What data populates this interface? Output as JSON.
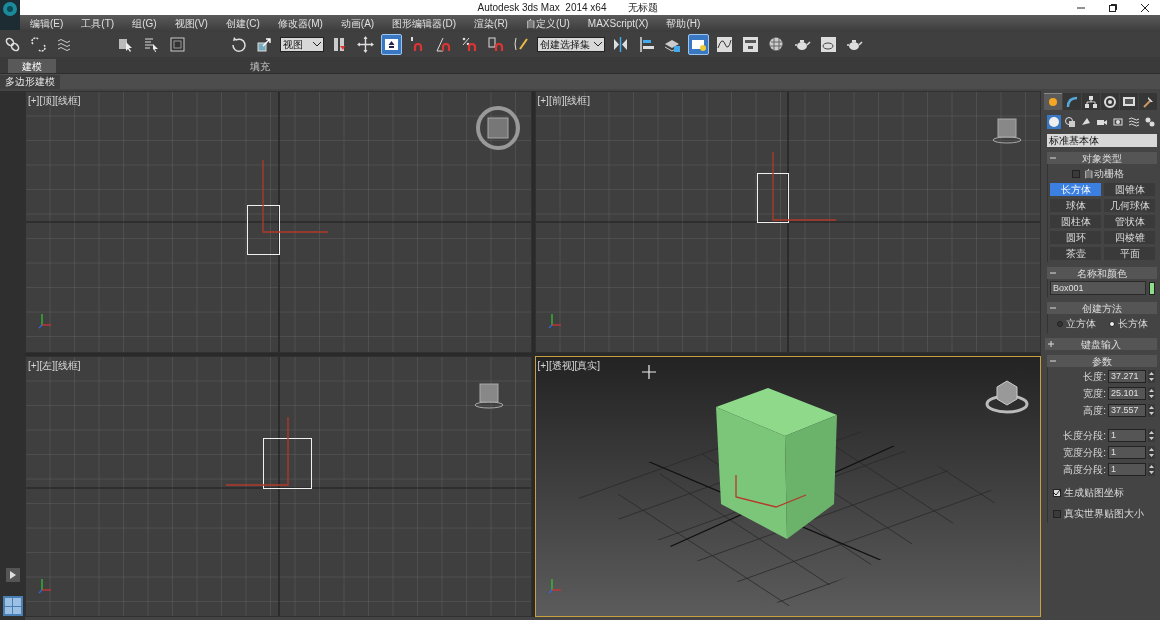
{
  "window": {
    "title": "Autodesk 3ds Max  2014 x64",
    "document": "无标题"
  },
  "menu": [
    "编辑(E)",
    "工具(T)",
    "组(G)",
    "视图(V)",
    "创建(C)",
    "修改器(M)",
    "动画(A)",
    "图形编辑器(D)",
    "渲染(R)",
    "自定义(U)",
    "MAXScript(X)",
    "帮助(H)"
  ],
  "toolbar": [
    {
      "kind": "link",
      "selected": false
    },
    {
      "kind": "unlink",
      "selected": false
    },
    {
      "kind": "wave",
      "selected": false
    },
    {
      "kind": "gap"
    },
    {
      "kind": "cursor",
      "selected": false
    },
    {
      "kind": "list",
      "selected": false
    },
    {
      "kind": "region",
      "selected": false
    },
    {
      "kind": "gap"
    },
    {
      "kind": "rotate",
      "selected": false
    },
    {
      "kind": "scale",
      "selected": false
    },
    {
      "kind": "dropdown",
      "value": "视图"
    },
    {
      "kind": "pivot",
      "selected": false
    },
    {
      "kind": "move",
      "selected": false
    },
    {
      "kind": "shortcut",
      "selected": true
    },
    {
      "kind": "snap",
      "selected": false
    },
    {
      "kind": "angle",
      "selected": false
    },
    {
      "kind": "percent",
      "selected": false
    },
    {
      "kind": "spinner",
      "selected": false
    },
    {
      "kind": "named",
      "selected": false
    },
    {
      "kind": "dropdown",
      "value": "创建选择集"
    },
    {
      "kind": "mirror",
      "selected": false
    },
    {
      "kind": "align",
      "selected": false
    },
    {
      "kind": "layers",
      "selected": false
    },
    {
      "kind": "explorer",
      "selected": true
    },
    {
      "kind": "curve",
      "selected": false
    },
    {
      "kind": "schematic",
      "selected": false
    },
    {
      "kind": "material",
      "selected": false
    },
    {
      "kind": "teapot",
      "selected": false
    },
    {
      "kind": "frame",
      "selected": false
    },
    {
      "kind": "teapot",
      "selected": false
    }
  ],
  "ribbon_tabs": [
    {
      "label": "建模",
      "selected": true
    },
    {
      "label": "填充",
      "selected": false
    }
  ],
  "ribbon_panel": "多边形建模",
  "viewports": [
    {
      "label": "[+][顶][线框]",
      "kind": "top",
      "active": false
    },
    {
      "label": "[+][前][线框]",
      "kind": "front",
      "active": false
    },
    {
      "label": "[+][左][线框]",
      "kind": "left",
      "active": false
    },
    {
      "label": "[+][透视][真实]",
      "kind": "perspective",
      "active": true
    }
  ],
  "command_panel": {
    "tabs": [
      {
        "kind": "create",
        "selected": true
      },
      {
        "kind": "modify",
        "selected": false
      },
      {
        "kind": "hierarchy",
        "selected": false
      },
      {
        "kind": "motion",
        "selected": false
      },
      {
        "kind": "display",
        "selected": false
      },
      {
        "kind": "utilities",
        "selected": false
      }
    ],
    "subtabs": [
      {
        "kind": "geometry",
        "selected": true
      },
      {
        "kind": "shapes",
        "selected": false
      },
      {
        "kind": "lights",
        "selected": false
      },
      {
        "kind": "cameras",
        "selected": false
      },
      {
        "kind": "helpers",
        "selected": false
      },
      {
        "kind": "spacewarps",
        "selected": false
      },
      {
        "kind": "systems",
        "selected": false
      }
    ],
    "category": "标准基本体",
    "rollouts": [
      {
        "kind": "object_type",
        "title": "对象类型",
        "expanded": true,
        "autogrid": {
          "label": "自动栅格",
          "checked": false
        },
        "buttons": [
          {
            "label": "长方体",
            "selected": true
          },
          {
            "label": "圆锥体",
            "selected": false
          },
          {
            "label": "球体",
            "selected": false
          },
          {
            "label": "几何球体",
            "selected": false
          },
          {
            "label": "圆柱体",
            "selected": false
          },
          {
            "label": "管状体",
            "selected": false
          },
          {
            "label": "圆环",
            "selected": false
          },
          {
            "label": "四棱锥",
            "selected": false
          },
          {
            "label": "茶壶",
            "selected": false
          },
          {
            "label": "平面",
            "selected": false
          }
        ]
      },
      {
        "kind": "name_color",
        "title": "名称和颜色",
        "expanded": true,
        "name": "Box001"
      },
      {
        "kind": "creation_method",
        "title": "创建方法",
        "expanded": true,
        "options": [
          {
            "label": "立方体",
            "selected": false
          },
          {
            "label": "长方体",
            "selected": true
          }
        ]
      },
      {
        "kind": "keyboard",
        "title": "键盘输入",
        "expanded": false
      },
      {
        "kind": "parameters",
        "title": "参数",
        "expanded": true,
        "fields": [
          {
            "label": "长度:",
            "value": "37.271"
          },
          {
            "label": "宽度:",
            "value": "25.101"
          },
          {
            "label": "高度:",
            "value": "37.557"
          },
          {
            "label": "长度分段:",
            "value": "1"
          },
          {
            "label": "宽度分段:",
            "value": "1"
          },
          {
            "label": "高度分段:",
            "value": "1"
          }
        ],
        "checks": [
          {
            "label": "生成贴图坐标",
            "checked": true
          },
          {
            "label": "真实世界贴图大小",
            "checked": false
          }
        ]
      }
    ]
  }
}
